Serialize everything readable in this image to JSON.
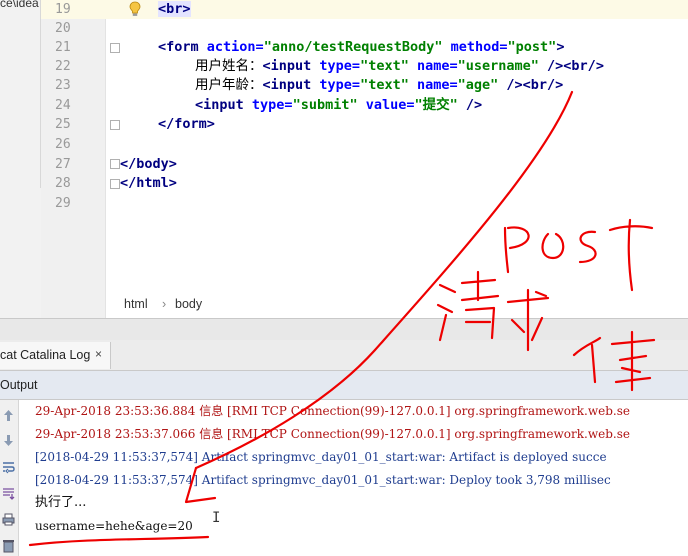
{
  "project": {
    "path_fragment": "ce\\idea"
  },
  "editor": {
    "line_numbers": [
      "19",
      "20",
      "21",
      "22",
      "23",
      "24",
      "25",
      "26",
      "27",
      "28",
      "29"
    ],
    "line19": {
      "tag": "<br>"
    },
    "line21": {
      "open": "<form",
      "attr_action": "action=",
      "val_action": "\"anno/testRequestBody\"",
      "attr_method": "method=",
      "val_method": "\"post\"",
      "close": ">"
    },
    "line22": {
      "label": "用户姓名：",
      "open": "<input",
      "attr_type": "type=",
      "val_type": "\"text\"",
      "attr_name": "name=",
      "val_name": "\"username\"",
      "close": "/><br/>"
    },
    "line23": {
      "label": "用户年龄：",
      "open": "<input",
      "attr_type": "type=",
      "val_type": "\"text\"",
      "attr_name": "name=",
      "val_name": "\"age\"",
      "close": "/><br/>"
    },
    "line24": {
      "open": "<input",
      "attr_type": "type=",
      "val_type": "\"submit\"",
      "attr_value": "value=",
      "val_value": "\"提交\"",
      "close": "/>"
    },
    "line25": "</form>",
    "line27": "</body>",
    "line28": "</html>"
  },
  "breadcrumb": {
    "items": [
      "html",
      "body"
    ],
    "separator": "›"
  },
  "tool_window": {
    "tab_label": "cat Catalina Log",
    "tab_close": "×",
    "output_label": "Output"
  },
  "console": {
    "lines": [
      "29-Apr-2018 23:53:36.884 信息 [RMI TCP Connection(99)-127.0.0.1] org.springframework.web.se",
      "29-Apr-2018 23:53:37.066 信息 [RMI TCP Connection(99)-127.0.0.1] org.springframework.web.se",
      "[2018-04-29 11:53:37,574] Artifact springmvc_day01_01_start:war: Artifact is deployed succe",
      "[2018-04-29 11:53:37,574] Artifact springmvc_day01_01_start:war: Deploy took 3,798 millisec",
      "执行了...",
      "username=hehe&age=20"
    ]
  },
  "colors": {
    "tag": "#000080",
    "attribute": "#0000ff",
    "value": "#008000",
    "log_error": "#b01414",
    "log_info": "#1f3d8f",
    "annotation": "#ee0000"
  },
  "icons": [
    "lightbulb-icon",
    "fold-marker-icon",
    "up-arrow-icon",
    "down-arrow-icon",
    "soft-wrap-icon",
    "scroll-to-end-icon",
    "print-icon",
    "trash-icon"
  ]
}
